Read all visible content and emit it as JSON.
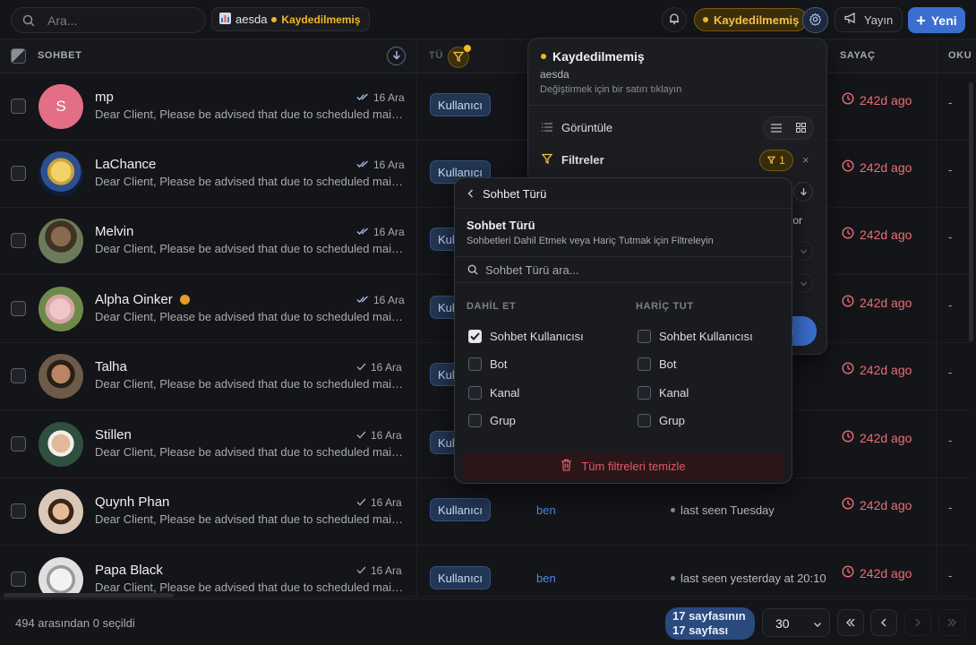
{
  "topbar": {
    "search_placeholder": "Ara...",
    "view_name": "aesda",
    "view_status": "Kaydedilmemiş",
    "unsaved_label": "Kaydedilmemiş",
    "broadcast_label": "Yayın",
    "new_label": "Yeni"
  },
  "table": {
    "headers": {
      "chat": "SOHBET",
      "type": "TÜ",
      "counter": "SAYAÇ",
      "read": "OKU"
    },
    "rows": [
      {
        "name": "mp",
        "avatar_letter": "S",
        "date": "16 Ara",
        "message": "Dear Client, Please be advised that due to scheduled maintenance",
        "tag": "Kullanıcı",
        "who": "",
        "seen": "",
        "ago": "242d ago",
        "dash": "-"
      },
      {
        "name": "LaChance",
        "avatar_letter": "",
        "date": "16 Ara",
        "message": "Dear Client, Please be advised that due to scheduled maintenance",
        "tag": "Kullanıcı",
        "who": "",
        "seen": "",
        "ago": "242d ago",
        "dash": "-"
      },
      {
        "name": "Melvin",
        "avatar_letter": "",
        "date": "16 Ara",
        "message": "Dear Client, Please be advised that due to scheduled maintenance",
        "tag": "Kullanıcı",
        "who": "",
        "seen": "",
        "ago": "242d ago",
        "dash": "-"
      },
      {
        "name": "Alpha Oinker",
        "avatar_letter": "",
        "date": "16 Ara",
        "message": "Dear Client, Please be advised that due to scheduled maintenance",
        "tag": "Kullanıcı",
        "who": "",
        "seen": "",
        "ago": "242d ago",
        "dash": "-"
      },
      {
        "name": "Talha",
        "avatar_letter": "",
        "date": "16 Ara",
        "message": "Dear Client, Please be advised that due to scheduled maintenance",
        "tag": "Kullanıcı",
        "who": "",
        "seen": "",
        "ago": "242d ago",
        "dash": "-"
      },
      {
        "name": "Stillen",
        "avatar_letter": "",
        "date": "16 Ara",
        "message": "Dear Client, Please be advised that due to scheduled maintenance",
        "tag": "Kullanıcı",
        "who": "",
        "seen": "",
        "ago": "242d ago",
        "dash": "-"
      },
      {
        "name": "Quynh Phan",
        "avatar_letter": "",
        "date": "16 Ara",
        "message": "Dear Client, Please be advised that due to scheduled maintenance",
        "tag": "Kullanıcı",
        "who": "ben",
        "seen": "last seen Tuesday",
        "ago": "242d ago",
        "dash": "-"
      },
      {
        "name": "Papa Black",
        "avatar_letter": "",
        "date": "16 Ara",
        "message": "Dear Client, Please be advised that due to scheduled maintenance",
        "tag": "Kullanıcı",
        "who": "ben",
        "seen": "last seen yesterday at 20:10",
        "ago": "242d ago",
        "dash": "-"
      }
    ]
  },
  "footer": {
    "selection": "494 arasından 0 seçildi",
    "page_line1": "17 sayfasının",
    "page_line2": "17 sayfası",
    "per_page": "30"
  },
  "view_panel": {
    "title": "Kaydedilmemiş",
    "view_name": "aesda",
    "hint": "Değiştirmek için bir satırı tıklayın",
    "display_label": "Görüntüle",
    "filters_label": "Filtreler",
    "filter_count": "1",
    "clear_x": "×",
    "partial_label": "liyor",
    "save_partial": "esi"
  },
  "filter_dropdown": {
    "back_label": "Sohbet Türü",
    "title": "Sohbet Türü",
    "description": "Sohbetleri Dahil Etmek veya Hariç Tutmak için Filtreleyin",
    "search_placeholder": "Sohbet Türü ara...",
    "include_header": "DAHİL ET",
    "exclude_header": "HARİÇ TUT",
    "include_options": [
      {
        "label": "Sohbet Kullanıcısı",
        "checked": true
      },
      {
        "label": "Bot",
        "checked": false
      },
      {
        "label": "Kanal",
        "checked": false
      },
      {
        "label": "Grup",
        "checked": false
      }
    ],
    "exclude_options": [
      {
        "label": "Sohbet Kullanıcısı",
        "checked": false
      },
      {
        "label": "Bot",
        "checked": false
      },
      {
        "label": "Kanal",
        "checked": false
      },
      {
        "label": "Grup",
        "checked": false
      }
    ],
    "clear_all": "Tüm filtreleri temizle"
  },
  "colors": {
    "accent": "#3a6fd1",
    "warning": "#f2b823",
    "danger": "#ea6d78",
    "background": "#141518"
  }
}
